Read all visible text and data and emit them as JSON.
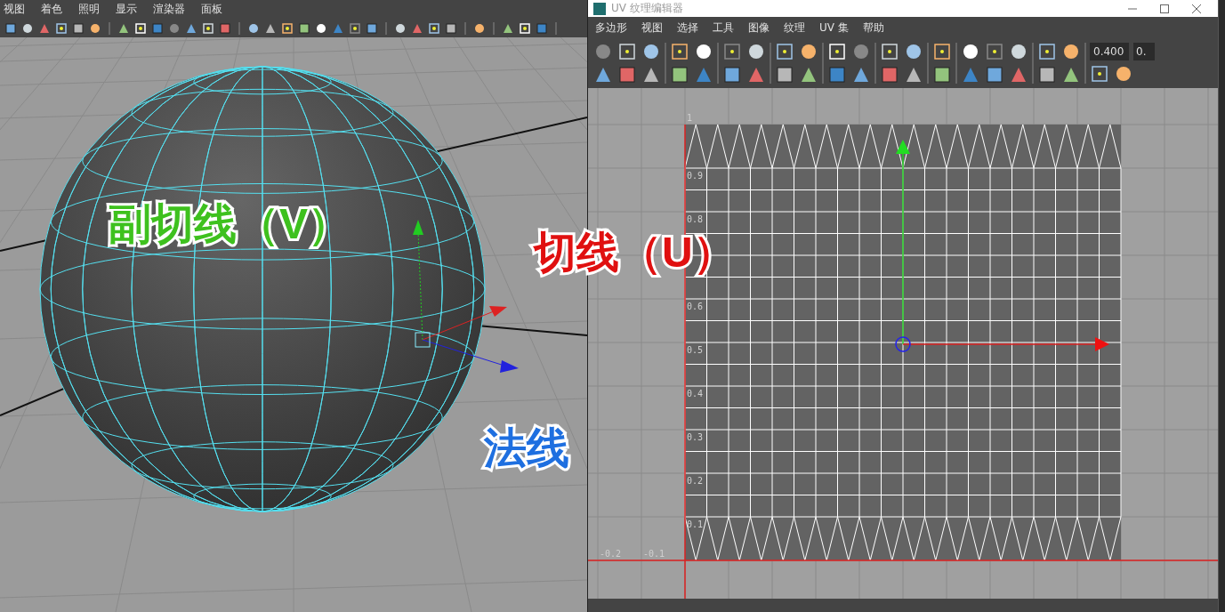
{
  "viewport": {
    "menu": [
      {
        "label": "视图"
      },
      {
        "label": "着色"
      },
      {
        "label": "照明"
      },
      {
        "label": "显示"
      },
      {
        "label": "渲染器"
      },
      {
        "label": "面板"
      }
    ]
  },
  "uv_editor": {
    "title": "UV 纹理编辑器",
    "menu": [
      {
        "label": "多边形"
      },
      {
        "label": "视图"
      },
      {
        "label": "选择"
      },
      {
        "label": "工具"
      },
      {
        "label": "图像"
      },
      {
        "label": "纹理"
      },
      {
        "label": "UV 集"
      },
      {
        "label": "帮助"
      }
    ],
    "fields": [
      "0.400",
      "0."
    ],
    "v_ticks": [
      "1",
      "0.9",
      "0.8",
      "0.6",
      "0.5",
      "0.4",
      "0.3",
      "0.2",
      "0.1"
    ],
    "u_ticks": [
      "-0.2",
      "-0.1"
    ]
  },
  "annotations": [
    {
      "text": "副切线（V）",
      "kind": "bitangent",
      "color": "#3ec11e"
    },
    {
      "text": "切线（U）",
      "kind": "tangent",
      "color": "#e01010"
    },
    {
      "text": "法线",
      "kind": "normal",
      "color": "#1e6fe0"
    }
  ]
}
